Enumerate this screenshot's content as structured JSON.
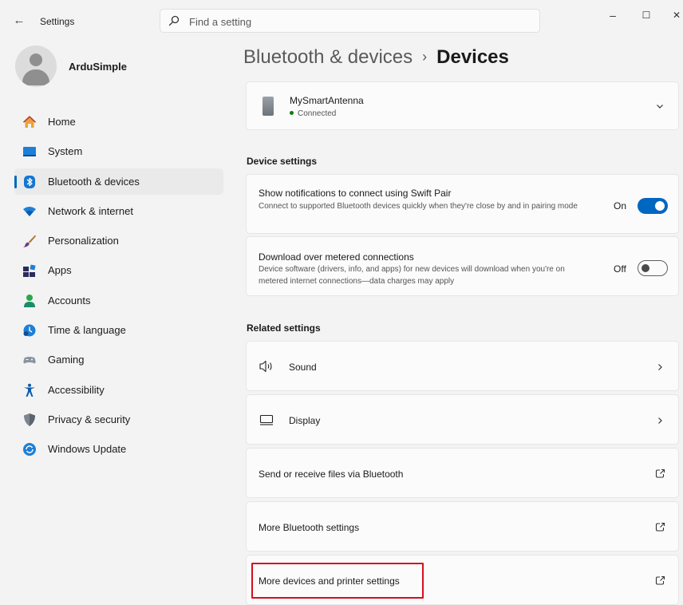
{
  "app": {
    "title": "Settings"
  },
  "search": {
    "placeholder": "Find a setting"
  },
  "window_controls": {
    "minimize": "–",
    "maximize": "☐",
    "close": "✕"
  },
  "profile": {
    "name": "ArduSimple"
  },
  "nav": {
    "active": "Bluetooth & devices",
    "items": [
      {
        "label": "Home",
        "icon": "home-icon"
      },
      {
        "label": "System",
        "icon": "system-icon"
      },
      {
        "label": "Bluetooth & devices",
        "icon": "bluetooth-icon"
      },
      {
        "label": "Network & internet",
        "icon": "wifi-icon"
      },
      {
        "label": "Personalization",
        "icon": "brush-icon"
      },
      {
        "label": "Apps",
        "icon": "apps-icon"
      },
      {
        "label": "Accounts",
        "icon": "accounts-icon"
      },
      {
        "label": "Time & language",
        "icon": "time-language-icon"
      },
      {
        "label": "Gaming",
        "icon": "gaming-icon"
      },
      {
        "label": "Accessibility",
        "icon": "accessibility-icon"
      },
      {
        "label": "Privacy & security",
        "icon": "shield-icon"
      },
      {
        "label": "Windows Update",
        "icon": "update-icon"
      }
    ]
  },
  "breadcrumb": {
    "parent": "Bluetooth & devices",
    "separator": "›",
    "current": "Devices"
  },
  "device": {
    "name": "MySmartAntenna",
    "status": "Connected"
  },
  "device_settings": {
    "heading": "Device settings",
    "swift_pair": {
      "title": "Show notifications to connect using Swift Pair",
      "description": "Connect to supported Bluetooth devices quickly when they're close by and in pairing mode",
      "state_label": "On",
      "enabled": true
    },
    "metered": {
      "title": "Download over metered connections",
      "description": "Device software (drivers, info, and apps) for new devices will download when you're on metered internet connections—data charges may apply",
      "state_label": "Off",
      "enabled": false
    }
  },
  "related_settings": {
    "heading": "Related settings",
    "items": [
      {
        "label": "Sound",
        "icon": "speaker-icon",
        "action": "chevron-right-icon"
      },
      {
        "label": "Display",
        "icon": "display-icon",
        "action": "chevron-right-icon"
      },
      {
        "label": "Send or receive files via Bluetooth",
        "action": "external-link-icon"
      },
      {
        "label": "More Bluetooth settings",
        "action": "external-link-icon"
      },
      {
        "label": "More devices and printer settings",
        "action": "external-link-icon",
        "highlighted": true
      }
    ]
  },
  "colors": {
    "accent": "#0067c0",
    "highlight_box": "#d40f1e",
    "connected_dot": "#0f7b0f",
    "background": "#f3f3f3",
    "card": "#fbfbfb"
  }
}
